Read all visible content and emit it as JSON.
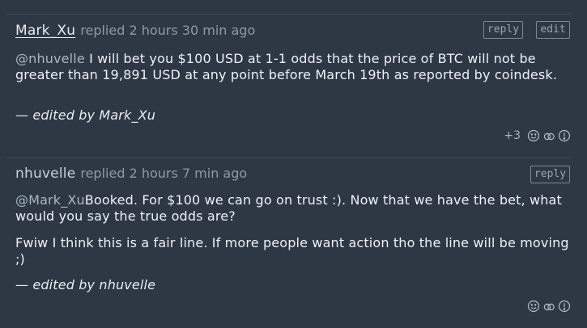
{
  "comments": [
    {
      "username": "Mark_Xu",
      "replied_text": "replied 2 hours 30 min ago",
      "reply_label": "reply",
      "edit_label": "edit",
      "mention": "@nhuvelle",
      "body": " I will bet you $100 USD at 1-1 odds that the price of BTC will not be greater than 19,891 USD at any point before March 19th as reported by coindesk.",
      "edited": "— edited by Mark_Xu",
      "votes": "+3"
    },
    {
      "username": "nhuvelle",
      "replied_text": "replied 2 hours 7 min ago",
      "reply_label": "reply",
      "mention": "@Mark_Xu",
      "body": "Booked. For $100 we can go on trust :). Now that we have the bet, what would you say the true odds are?",
      "body2": "Fwiw I think this is a fair line. If more people want action tho the line will be moving ;)",
      "edited": "— edited by nhuvelle"
    }
  ],
  "icons": {
    "react": "smiley-icon",
    "link": "link-icon",
    "flag": "flag-icon"
  }
}
